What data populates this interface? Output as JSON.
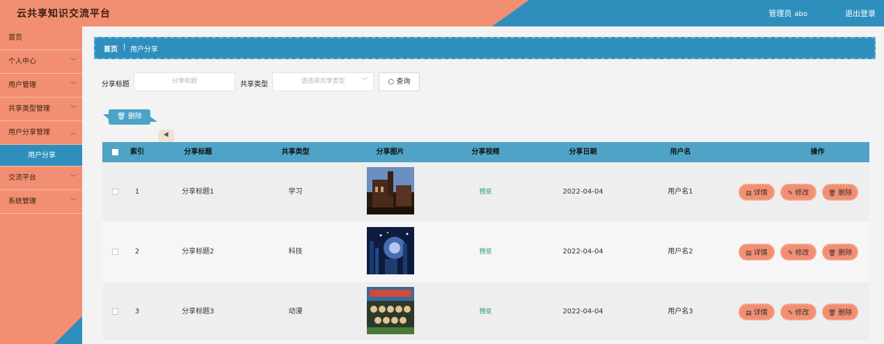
{
  "header": {
    "title": "云共享知识交流平台",
    "user_role": "管理员",
    "user_name": "abo",
    "logout": "退出登录"
  },
  "sidebar": {
    "items": [
      {
        "label": "首页",
        "expandable": false
      },
      {
        "label": "个人中心",
        "expandable": true
      },
      {
        "label": "用户管理",
        "expandable": true
      },
      {
        "label": "共享类型管理",
        "expandable": true
      },
      {
        "label": "用户分享管理",
        "expandable": true
      },
      {
        "label": "用户分享",
        "sub": true
      },
      {
        "label": "交流平台",
        "expandable": true
      },
      {
        "label": "系统管理",
        "expandable": true
      }
    ]
  },
  "breadcrumb": {
    "home": "首页",
    "current": "用户分享"
  },
  "search": {
    "title_label": "分享标题",
    "title_placeholder": "分享标题",
    "type_label": "共享类型",
    "type_placeholder": "请选择共享类型",
    "query_label": "查询"
  },
  "toolbar": {
    "delete_label": "删除"
  },
  "table": {
    "columns": [
      "索引",
      "分享标题",
      "共享类型",
      "分享图片",
      "分享视频",
      "分享日期",
      "用户名",
      "操作"
    ],
    "rows": [
      {
        "index": "1",
        "title": "分享标题1",
        "type": "学习",
        "video": "预览",
        "date": "2022-04-04",
        "user": "用户名1"
      },
      {
        "index": "2",
        "title": "分享标题2",
        "type": "科技",
        "video": "预览",
        "date": "2022-04-04",
        "user": "用户名2"
      },
      {
        "index": "3",
        "title": "分享标题3",
        "type": "动漫",
        "video": "预览",
        "date": "2022-04-04",
        "user": "用户名3"
      }
    ],
    "actions": {
      "detail": "详情",
      "edit": "修改",
      "delete": "删除"
    }
  },
  "colors": {
    "header_blue": "#2e8fbd",
    "salmon": "#f28f72",
    "table_head": "#4fa3c7",
    "preview_green": "#1a9a5c"
  }
}
